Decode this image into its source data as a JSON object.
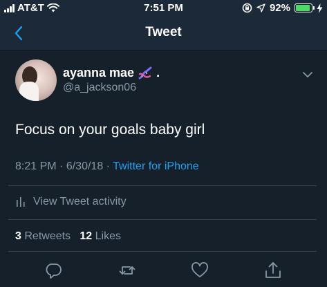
{
  "status_bar": {
    "carrier": "AT&T",
    "time": "7:51 PM",
    "battery_percent": "92%",
    "battery_level": 0.92
  },
  "nav": {
    "title": "Tweet",
    "back_icon": "chevron-left-icon"
  },
  "tweet": {
    "author_name": "ayanna mae",
    "author_suffix": ".",
    "author_emoji": "dna-icon",
    "handle": "@a_jackson06",
    "text": "Focus on your goals baby girl",
    "time": "8:21 PM",
    "date": "6/30/18",
    "separator": "·",
    "source": "Twitter for iPhone",
    "activity_label": "View Tweet activity",
    "retweet_count": "3",
    "retweet_label": "Retweets",
    "like_count": "12",
    "like_label": "Likes"
  },
  "colors": {
    "background": "#15202b",
    "bar": "#1c2938",
    "accent": "#1da1f2",
    "muted": "#8899a6",
    "battery": "#4cd964"
  }
}
